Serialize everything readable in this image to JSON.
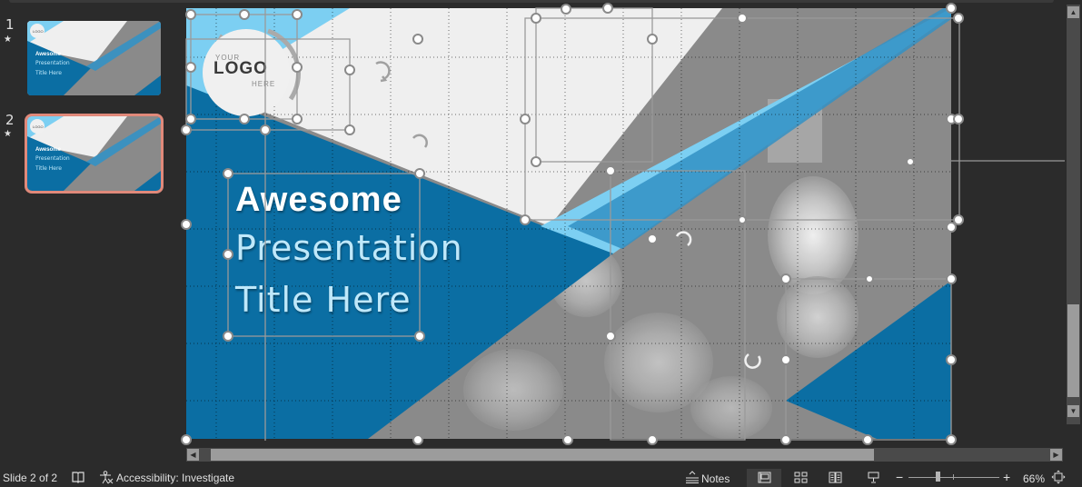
{
  "thumbnails": [
    {
      "number": "1",
      "star": "★",
      "selected": false,
      "logo": "LOGO",
      "line1": "Awesome",
      "line2": "Presentation",
      "line3": "Title Here"
    },
    {
      "number": "2",
      "star": "★",
      "selected": true,
      "logo": "LOGO",
      "line1": "Awesome",
      "line2": "Presentation",
      "line3": "Title Here"
    }
  ],
  "slide": {
    "logo": {
      "top": "YOUR",
      "main": "LOGO",
      "bottom": "HERE"
    },
    "title": {
      "line1": "Awesome",
      "line2": "Presentation",
      "line3": "Title Here"
    },
    "colors": {
      "dark_blue": "#0b6ea3",
      "light_blue": "#7ccff2",
      "mid_blue": "#3391c4",
      "light_bg": "#efefef",
      "photo_gray": "#8a8a8a"
    }
  },
  "status_bar": {
    "slide_indicator": "Slide 2 of 2",
    "accessibility": "Accessibility: Investigate",
    "notes_label": "Notes",
    "zoom_minus": "−",
    "zoom_plus": "+",
    "zoom_level": "66%",
    "zoom_fraction": 0.66
  },
  "scrollbars": {
    "up_arrow": "▲",
    "down_arrow": "▼",
    "left_arrow": "◀",
    "right_arrow": "▶"
  }
}
